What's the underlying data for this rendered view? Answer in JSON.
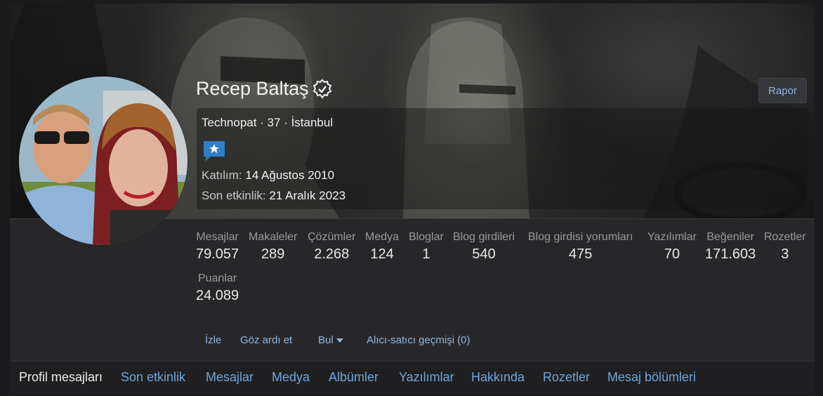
{
  "profile": {
    "username": "Recep Baltaş",
    "title_line": "Technopat · 37 · İstanbul",
    "joined_label": "Katılım:",
    "joined_date": "14 Ağustos 2010",
    "last_activity_label": "Son etkinlik:",
    "last_activity_date": "21 Aralık 2023",
    "verified_icon": "verified-badge-icon",
    "badge_icon": "star-speech-badge-icon"
  },
  "report_button": "Rapor",
  "stats": [
    {
      "label": "Mesajlar",
      "value": "79.057"
    },
    {
      "label": "Makaleler",
      "value": "289"
    },
    {
      "label": "Çözümler",
      "value": "2.268"
    },
    {
      "label": "Medya",
      "value": "124"
    },
    {
      "label": "Bloglar",
      "value": "1"
    },
    {
      "label": "Blog girdileri",
      "value": "540"
    },
    {
      "label": "Blog girdisi yorumları",
      "value": "475"
    },
    {
      "label": "Yazılımlar",
      "value": "70"
    },
    {
      "label": "Beğeniler",
      "value": "171.603"
    },
    {
      "label": "Rozetler",
      "value": "3"
    },
    {
      "label": "Puanlar",
      "value": "24.089"
    }
  ],
  "actions": {
    "follow": "İzle",
    "ignore": "Göz ardı et",
    "find": "Bul",
    "trader_history": "Alıcı-satıcı geçmişi (0)"
  },
  "tabs": [
    "Profil mesajları",
    "Son etkinlik",
    "Mesajlar",
    "Medya",
    "Albümler",
    "Yazılımlar",
    "Hakkında",
    "Rozetler",
    "Mesaj bölümleri"
  ],
  "colors": {
    "link": "#6fa6db",
    "background": "#27272a",
    "page": "#1b1b1d"
  }
}
